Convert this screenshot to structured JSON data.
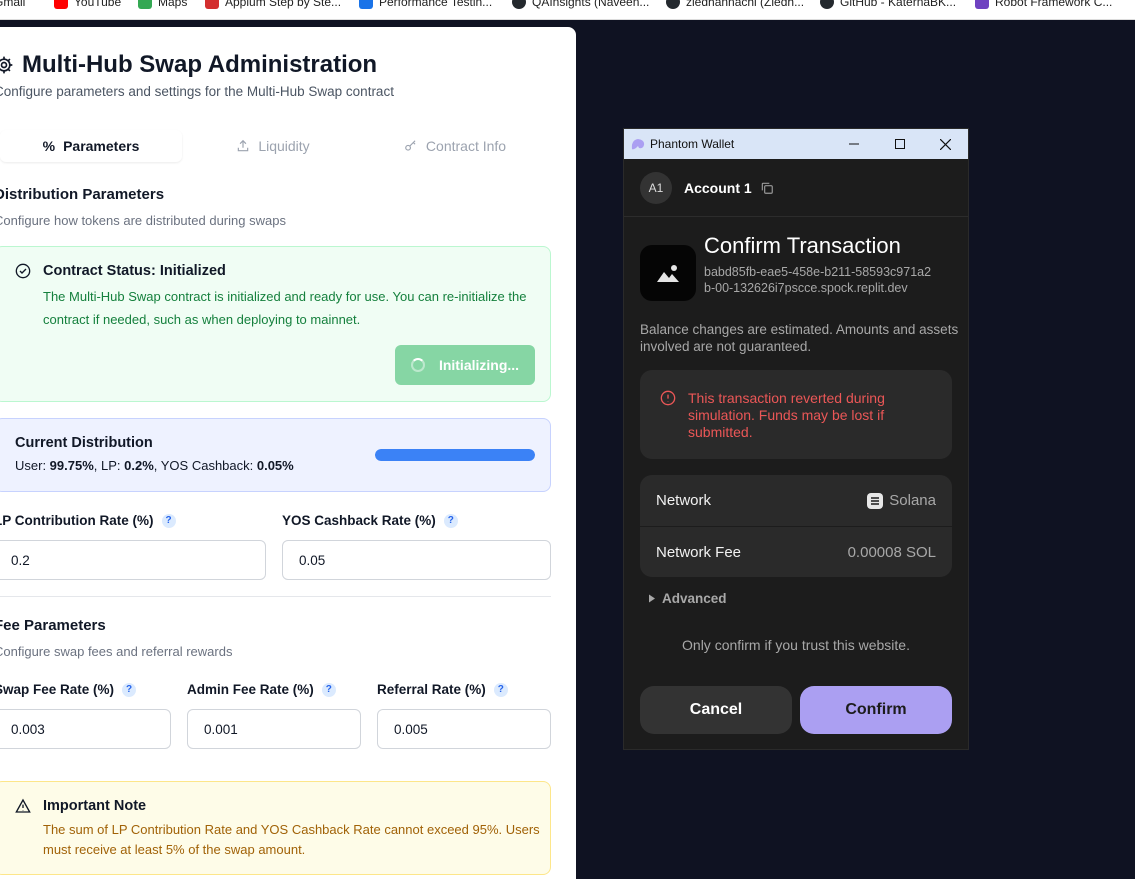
{
  "bookmarks": [
    {
      "label": "Gmail",
      "color": "#ea4335"
    },
    {
      "label": "YouTube",
      "color": "#ff0000"
    },
    {
      "label": "Maps",
      "color": "#34a853"
    },
    {
      "label": "Appium Step by Ste...",
      "color": "#d32f2f"
    },
    {
      "label": "Performance Testin...",
      "color": "#1a73e8"
    },
    {
      "label": "QAInsights (Naveen...",
      "color": "#24292e"
    },
    {
      "label": "ziedhannachi (Ziedh...",
      "color": "#24292e"
    },
    {
      "label": "GitHub - KaternaBK...",
      "color": "#24292e"
    },
    {
      "label": "Robot Framework C...",
      "color": "#6f42c1"
    }
  ],
  "admin": {
    "title": "Multi-Hub Swap Administration",
    "subtitle": "Configure parameters and settings for the Multi-Hub Swap contract",
    "tabs": [
      {
        "label": "Parameters",
        "icon": "percent-icon",
        "active": true
      },
      {
        "label": "Liquidity",
        "icon": "upload-icon",
        "active": false
      },
      {
        "label": "Contract Info",
        "icon": "key-icon",
        "active": false
      }
    ],
    "distribution": {
      "title": "Distribution Parameters",
      "subtitle": "Configure how tokens are distributed during swaps"
    },
    "status": {
      "title": "Contract Status: Initialized",
      "message": "The Multi-Hub Swap contract is initialized and ready for use. You can re-initialize the contract if needed, such as when deploying to mainnet.",
      "button_label": "Initializing..."
    },
    "current": {
      "title": "Current Distribution",
      "user_label": "User: ",
      "user_value": "99.75%",
      "lp_label": ", LP: ",
      "lp_value": "0.2%",
      "yos_label": ", YOS Cashback: ",
      "yos_value": "0.05%",
      "bar_fill_percent": 99.75
    },
    "lp_rate": {
      "label": "LP Contribution Rate (%)",
      "value": "0.2"
    },
    "yos_rate": {
      "label": "YOS Cashback Rate (%)",
      "value": "0.05"
    },
    "fee": {
      "title": "Fee Parameters",
      "subtitle": "Configure swap fees and referral rewards",
      "swap": {
        "label": "Swap Fee Rate (%)",
        "value": "0.003"
      },
      "admin": {
        "label": "Admin Fee Rate (%)",
        "value": "0.001"
      },
      "referral": {
        "label": "Referral Rate (%)",
        "value": "0.005"
      }
    },
    "note": {
      "title": "Important Note",
      "message": "The sum of LP Contribution Rate and YOS Cashback Rate cannot exceed 95%. Users must receive at least 5% of the swap amount."
    },
    "help_glyph": "?"
  },
  "wallet": {
    "window_title": "Phantom Wallet",
    "account_avatar": "A1",
    "account_name": "Account 1",
    "confirm_title": "Confirm Transaction",
    "site_url": "babd85fb-eae5-458e-b211-58593c971a2b-00-132626i7pscce.spock.replit.dev",
    "balance_note": "Balance changes are estimated. Amounts and assets involved are not guaranteed.",
    "error_message": "This transaction reverted during simulation. Funds may be lost if submitted.",
    "network_label": "Network",
    "network_value": "Solana",
    "fee_label": "Network Fee",
    "fee_value": "0.00008 SOL",
    "advanced_label": "Advanced",
    "trust_note": "Only confirm if you trust this website.",
    "cancel_label": "Cancel",
    "confirm_label": "Confirm",
    "accent_color": "#ab9ff2",
    "error_color": "#eb5757"
  }
}
